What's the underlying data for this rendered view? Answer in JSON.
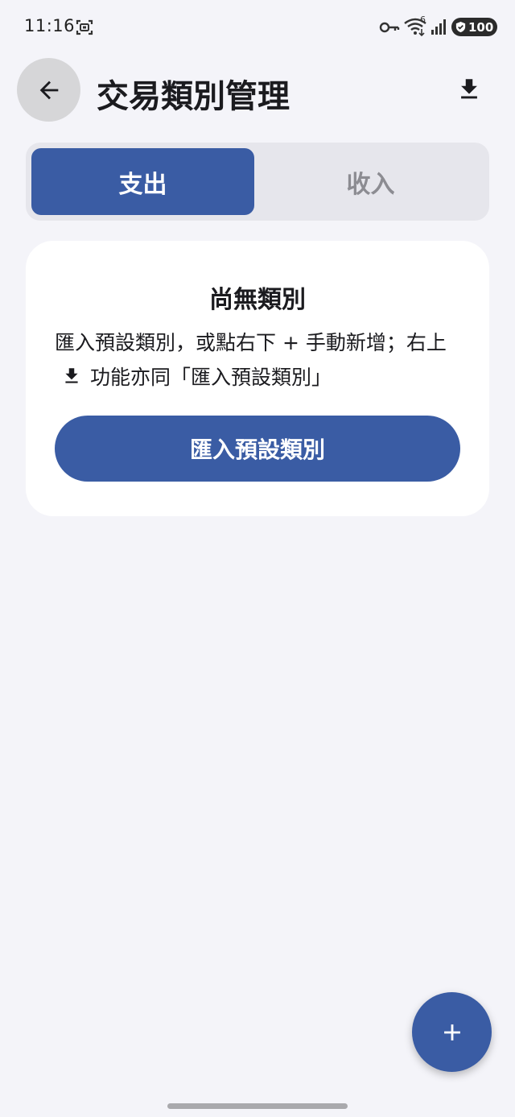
{
  "status_bar": {
    "time": "11:16",
    "wifi_generation": "6",
    "battery_level": "100"
  },
  "header": {
    "title": "交易類別管理",
    "back_icon": "arrow-back-icon",
    "action_icon": "download-icon"
  },
  "tabs": [
    {
      "label": "支出",
      "selected": true
    },
    {
      "label": "收入",
      "selected": false
    }
  ],
  "empty_state": {
    "title": "尚無類別",
    "description_part1": "匯入預設類別，或點右下 + 手動新增；右上",
    "description_icon": "download-icon",
    "description_part2": "功能亦同「匯入預設類別」",
    "button_label": "匯入預設類別"
  },
  "fab": {
    "icon": "plus-icon"
  },
  "colors": {
    "primary": "#3a5ca4",
    "background": "#f4f4f9",
    "card": "#ffffff",
    "tab_track": "#e6e6ec",
    "inactive_text": "#8c8c92"
  }
}
